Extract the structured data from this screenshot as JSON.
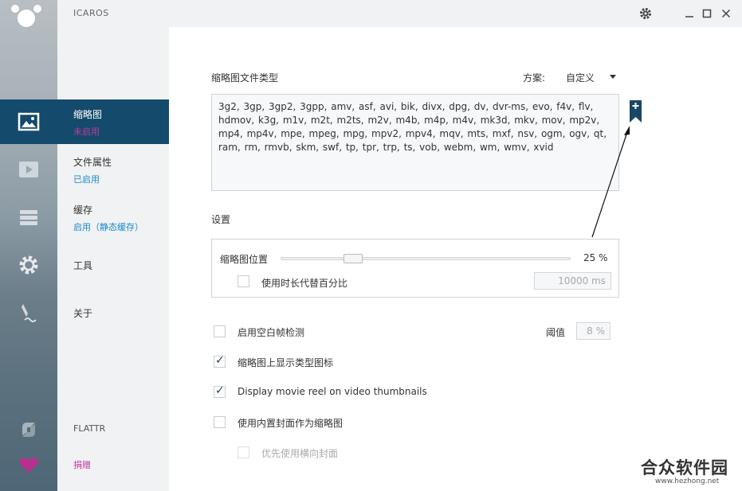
{
  "app": {
    "title": "ICAROS"
  },
  "menu": {
    "items": [
      {
        "label": "缩略图",
        "status": "未启用"
      },
      {
        "label": "文件属性",
        "status": "已启用"
      },
      {
        "label": "缓存",
        "status": "启用（静态缓存）"
      },
      {
        "label": "工具",
        "status": ""
      },
      {
        "label": "关于",
        "status": ""
      }
    ],
    "flattr": "FLATTR",
    "donate": "捐赠"
  },
  "thumbnails": {
    "section_title": "缩略图文件类型",
    "scheme_label": "方案:",
    "scheme_value": "自定义",
    "file_types": "3g2, 3gp, 3gp2, 3gpp, amv, asf, avi, bik, divx, dpg, dv, dvr-ms, evo, f4v, flv, hdmov, k3g, m1v, m2t, m2ts, m2v, m4b, m4p, m4v, mk3d, mkv, mov, mp2v, mp4, mp4v, mpe, mpeg, mpg, mpv2, mpv4, mqv, mts, mxf, nsv, ogm, ogv, qt, ram, rm, rmvb, skm, swf, tp, tpr, trp, ts, vob, webm, wm, wmv, xvid",
    "settings_title": "设置",
    "position_label": "缩略图位置",
    "position_value": "25 %",
    "position_fraction": 0.25,
    "use_duration_label": "使用时长代替百分比",
    "duration_value": "10000 ms",
    "blank_frame_label": "启用空白帧检测",
    "threshold_label": "阈值",
    "threshold_value": "8 %",
    "show_type_icon_label": "缩略图上显示类型图标",
    "movie_reel_label": "Display movie reel on video thumbnails",
    "embedded_cover_label": "使用内置封面作为缩略图",
    "landscape_cover_label": "优先使用横向封面"
  },
  "watermark": {
    "main": "合众软件园",
    "sub": "www.hezhong.net"
  },
  "colors": {
    "accent": "#144a6c",
    "status_off": "#c03aa0",
    "status_on": "#1a8ac8",
    "donate": "#c03aa0"
  }
}
